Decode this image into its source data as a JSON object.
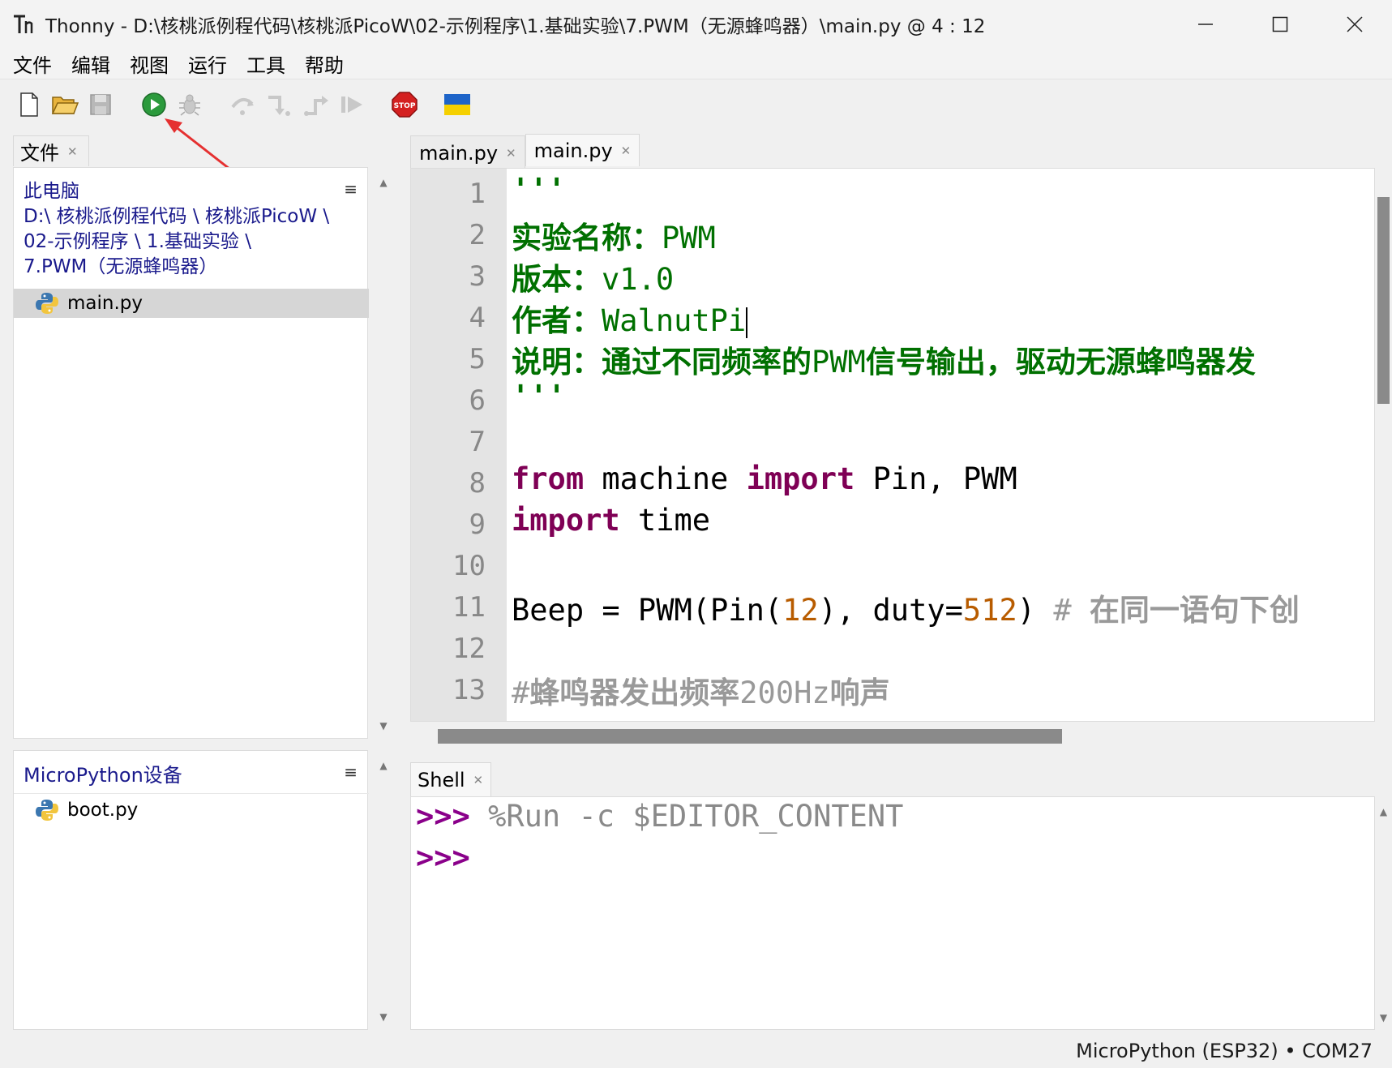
{
  "window": {
    "title": "Thonny  -  D:\\核桃派例程代码\\核桃派PicoW\\02-示例程序\\1.基础实验\\7.PWM（无源蜂鸣器）\\main.py  @  4 : 12",
    "icons": {
      "minimize": "minimize-icon",
      "maximize": "maximize-icon",
      "close": "close-icon"
    }
  },
  "menu": {
    "items": [
      "文件",
      "编辑",
      "视图",
      "运行",
      "工具",
      "帮助"
    ]
  },
  "toolbar": {
    "buttons": [
      "new-file-icon",
      "open-file-icon",
      "save-file-icon",
      "run-icon",
      "debug-icon",
      "step-over-icon",
      "step-into-icon",
      "step-out-icon",
      "resume-icon",
      "stop-icon",
      "ukraine-flag-icon"
    ]
  },
  "files_panel": {
    "tab_label": "文件",
    "path_lines": [
      "此电脑",
      "D:\\ 核桃派例程代码 \\ 核桃派PicoW \\",
      "02-示例程序 \\ 1.基础实验 \\",
      "7.PWM（无源蜂鸣器）"
    ],
    "files": [
      {
        "name": "main.py",
        "selected": true
      }
    ]
  },
  "device_panel": {
    "title": "MicroPython设备",
    "files": [
      {
        "name": "boot.py"
      }
    ]
  },
  "editor": {
    "tabs": [
      {
        "label": "main.py",
        "active": false
      },
      {
        "label": "main.py",
        "active": true
      }
    ],
    "line_numbers": [
      "1",
      "2",
      "3",
      "4",
      "5",
      "6",
      "7",
      "8",
      "9",
      "10",
      "11",
      "12",
      "13"
    ],
    "code": {
      "l1": "'''",
      "l2_label": "实验名称：",
      "l2_value": "PWM",
      "l3_label": "版本：",
      "l3_value": "v1.0",
      "l4_label": "作者：",
      "l4_value": "WalnutPi",
      "l5_a": "说明：通过不同频率的",
      "l5_b": "PWM",
      "l5_c": "信号输出，驱动无源蜂鸣器发",
      "l6": "'''",
      "l8_kw1": "from",
      "l8_mid": " machine ",
      "l8_kw2": "import",
      "l8_rest": " Pin, PWM",
      "l9_kw": "import",
      "l9_rest": " time",
      "l11_a": "Beep = PWM(Pin(",
      "l11_n1": "12",
      "l11_b": "), duty=",
      "l11_n2": "512",
      "l11_c": ") ",
      "l11_cmt_hash": "# ",
      "l11_cmt": "在同一语句下创",
      "l13_a": "#",
      "l13_b": "蜂鸣器发出频率",
      "l13_c": "200Hz",
      "l13_d": "响声"
    }
  },
  "shell": {
    "tab_label": "Shell",
    "prompt": ">>>",
    "command": "%Run -c $EDITOR_CONTENT"
  },
  "status": {
    "text": "MicroPython (ESP32)  •  COM27"
  },
  "colors": {
    "string": "#007000",
    "keyword": "#7f0055",
    "number": "#b85c00",
    "comment": "#999999",
    "prompt": "#8a008a",
    "path": "#1a1a8c"
  }
}
